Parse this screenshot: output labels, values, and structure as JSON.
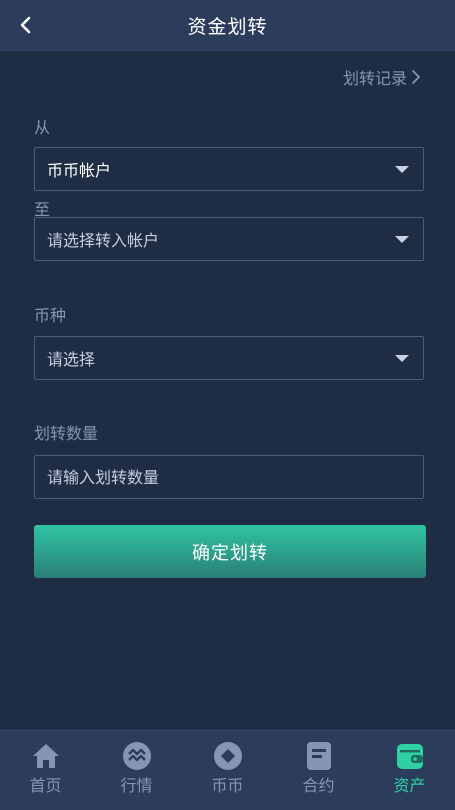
{
  "header": {
    "title": "资金划转",
    "back_icon": "chevron-left-icon"
  },
  "records_link": "划转记录",
  "from": {
    "label": "从",
    "value": "币币帐户"
  },
  "to": {
    "label": "至",
    "placeholder": "请选择转入帐户"
  },
  "currency": {
    "label": "币种",
    "placeholder": "请选择"
  },
  "amount": {
    "label": "划转数量",
    "placeholder": "请输入划转数量"
  },
  "confirm_button": "确定划转",
  "tabbar": [
    {
      "label": "首页",
      "icon": "home-icon"
    },
    {
      "label": "行情",
      "icon": "market-icon"
    },
    {
      "label": "币币",
      "icon": "coin-icon"
    },
    {
      "label": "合约",
      "icon": "contract-icon"
    },
    {
      "label": "资产",
      "icon": "wallet-icon",
      "active": true
    }
  ],
  "colors": {
    "accent": "#2fd0a6",
    "background": "#1e2c44",
    "bar": "#2b3d5a"
  }
}
